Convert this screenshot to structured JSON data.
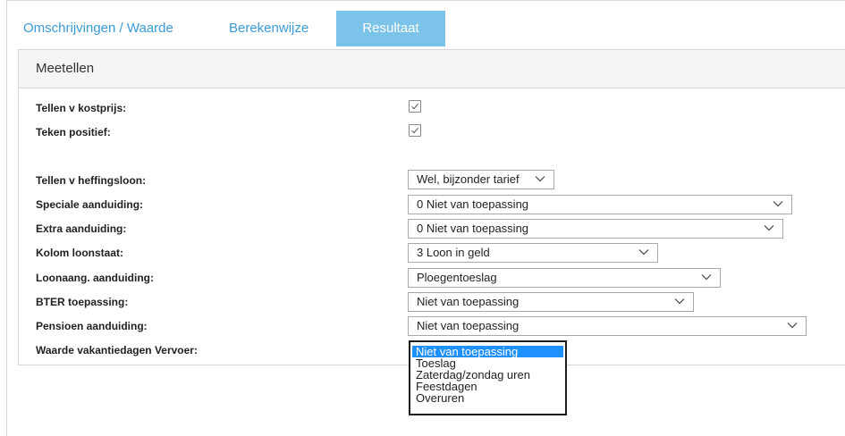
{
  "tabs": [
    {
      "label": "Omschrijvingen / Waarde"
    },
    {
      "label": "Berekenwijze"
    },
    {
      "label": "Resultaat"
    }
  ],
  "active_tab": "Resultaat",
  "panel": {
    "title": "Meetellen",
    "fields": {
      "tellen_kostprijs": {
        "label": "Tellen v kostprijs:",
        "checked": true
      },
      "teken_positief": {
        "label": "Teken positief:",
        "checked": true
      },
      "heffingsloon": {
        "label": "Tellen v heffingsloon:",
        "value": "Wel, bijzonder tarief"
      },
      "speciale": {
        "label": "Speciale aanduiding:",
        "value": "0 Niet van toepassing"
      },
      "extra": {
        "label": "Extra aanduiding:",
        "value": "0 Niet van toepassing"
      },
      "kolom": {
        "label": "Kolom loonstaat:",
        "value": "3 Loon in geld"
      },
      "loonaang": {
        "label": "Loonaang. aanduiding:",
        "value": "Ploegentoeslag"
      },
      "bter": {
        "label": "BTER toepassing:",
        "value": "Niet van toepassing"
      },
      "pensioen": {
        "label": "Pensioen aanduiding:",
        "value": "Niet van toepassing"
      },
      "vakantiedagen": {
        "label": "Waarde vakantiedagen Vervoer:",
        "options": [
          "Niet van toepassing",
          "Toeslag",
          "Zaterdag/zondag uren",
          "Feestdagen",
          "Overuren"
        ],
        "highlighted": "Niet van toepassing"
      }
    }
  },
  "colors": {
    "accent": "#3a9bd6",
    "active_tab_bg": "#7cc3ea",
    "highlight": "#1e90ff"
  },
  "icons": {
    "checkbox": "checkmark-icon",
    "select": "chevron-down-icon"
  }
}
